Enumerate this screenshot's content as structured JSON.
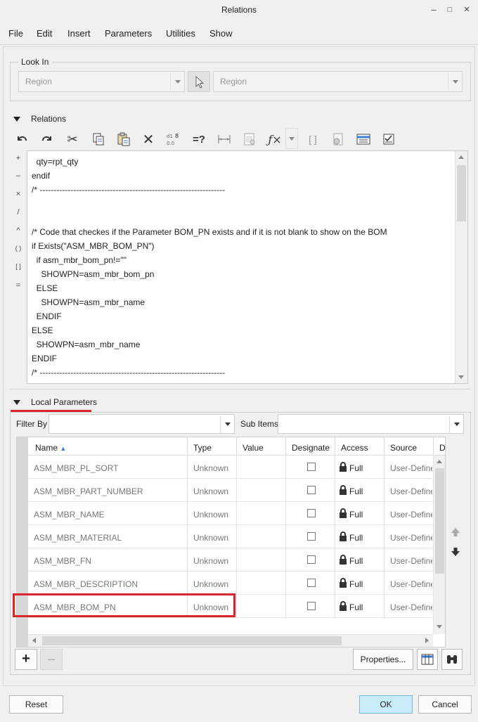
{
  "window": {
    "title": "Relations",
    "minimize": "–",
    "maximize": "□",
    "close": "✕"
  },
  "menu": [
    "File",
    "Edit",
    "Insert",
    "Parameters",
    "Utilities",
    "Show"
  ],
  "look_in": {
    "label": "Look In",
    "filter_value": "Region",
    "target_value": "Region"
  },
  "relations": {
    "label": "Relations",
    "side_buttons": [
      "+",
      "–",
      "×",
      "/",
      "^",
      "( )",
      "[ ]",
      "="
    ],
    "code": [
      "  qty=rpt_qty",
      "endif",
      "/* ------------------------------------------------------------------",
      "",
      "",
      "/* Code that checkes if the Parameter BOM_PN exists and if it is not blank to show on the BOM",
      "if Exists(\"ASM_MBR_BOM_PN\")",
      "  if asm_mbr_bom_pn!=\"\"",
      "    SHOWPN=asm_mbr_bom_pn",
      "  ELSE",
      "    SHOWPN=asm_mbr_name",
      "  ENDIF",
      "ELSE",
      "  SHOWPN=asm_mbr_name",
      "ENDIF",
      "/* ------------------------------------------------------------------"
    ]
  },
  "local_parameters": {
    "label": "Local Parameters",
    "filter_by_label": "Filter By",
    "sub_items_label": "Sub Items",
    "columns": [
      "Name",
      "Type",
      "Value",
      "Designate",
      "Access",
      "Source",
      "D"
    ],
    "rows": [
      {
        "name": "ASM_MBR_PL_SORT",
        "type": "Unknown",
        "value": "",
        "access": "Full",
        "source": "User-Defined"
      },
      {
        "name": "ASM_MBR_PART_NUMBER",
        "type": "Unknown",
        "value": "",
        "access": "Full",
        "source": "User-Defined"
      },
      {
        "name": "ASM_MBR_NAME",
        "type": "Unknown",
        "value": "",
        "access": "Full",
        "source": "User-Defined"
      },
      {
        "name": "ASM_MBR_MATERIAL",
        "type": "Unknown",
        "value": "",
        "access": "Full",
        "source": "User-Defined"
      },
      {
        "name": "ASM_MBR_FN",
        "type": "Unknown",
        "value": "",
        "access": "Full",
        "source": "User-Defined"
      },
      {
        "name": "ASM_MBR_DESCRIPTION",
        "type": "Unknown",
        "value": "",
        "access": "Full",
        "source": "User-Defined"
      },
      {
        "name": "ASM_MBR_BOM_PN",
        "type": "Unknown",
        "value": "",
        "access": "Full",
        "source": "User-Defined"
      }
    ],
    "add_label": "+",
    "remove_label": "–",
    "properties_label": "Properties..."
  },
  "footer": {
    "reset": "Reset",
    "ok": "OK",
    "cancel": "Cancel"
  },
  "colors": {
    "highlight_red": "#d9262c",
    "ok_bg": "#c9ecfb"
  }
}
